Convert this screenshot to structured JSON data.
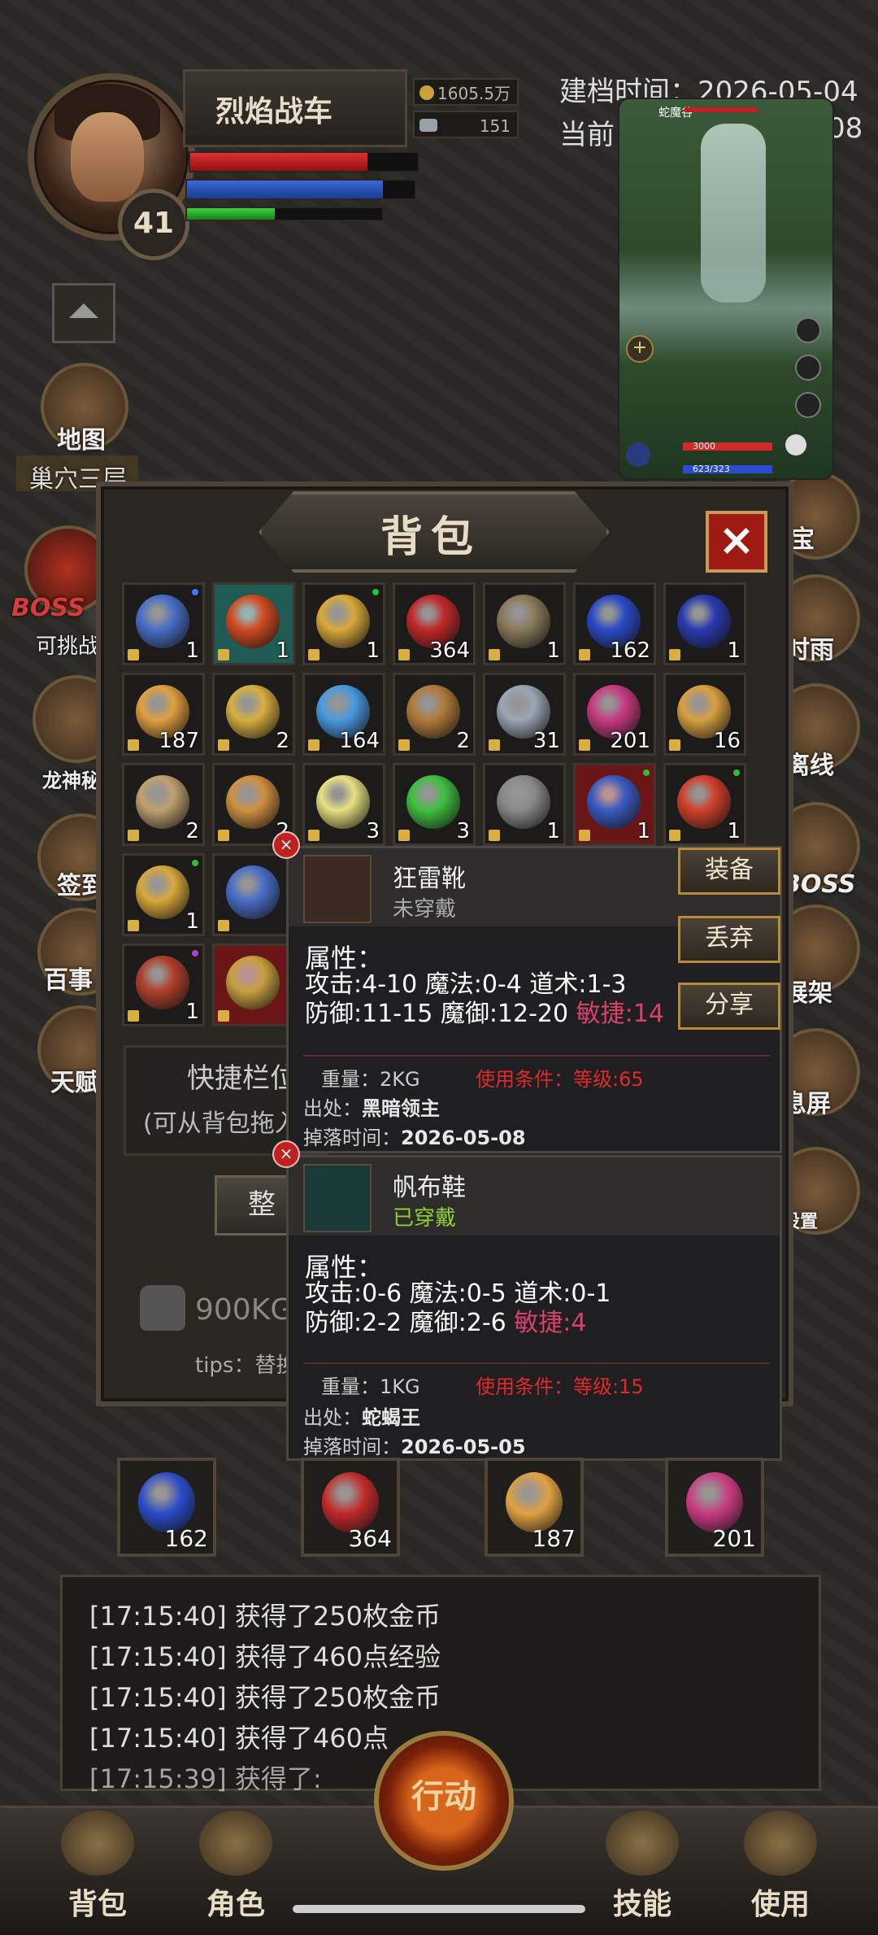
{
  "player": {
    "name": "烈焰战车",
    "level": "41",
    "gold": "1605.5万",
    "ingot": "151",
    "hp_fraction": 0.78,
    "mp_fraction": 0.86,
    "exp_fraction": 0.45
  },
  "archive": {
    "created": "建档时间：2026-05-04",
    "current_partial": "当前",
    "current_tail": "08"
  },
  "left_menu": {
    "map_label": "地图",
    "location": "巢穴三层",
    "boss_label": "BOSS",
    "challenge": "可挑战",
    "dragon": "龙神秘",
    "sign": "签到",
    "events": "百事",
    "tianshu": "天赋"
  },
  "right_menu": {
    "treasure": "宝",
    "rain": "时雨",
    "offline": "离线",
    "boss": "BOSS",
    "shelf": "展架",
    "screen": "息屏",
    "settings": "设置"
  },
  "minimap": {
    "title": "蛇魔谷",
    "hp": "3000",
    "mp": "623/323"
  },
  "bag": {
    "title": "背包",
    "close": "×",
    "quickbar_title": "快捷栏位",
    "quickbar_hint": "(可从背包拖入",
    "sort_button": "整",
    "weight": "900KG",
    "tips": "tips：替换重",
    "slots": [
      {
        "count": "1",
        "color": "#4a6ec8",
        "bg": "normal",
        "dot": "#3a7aff"
      },
      {
        "count": "1",
        "color": "#d24a20",
        "bg": "teal",
        "dot": ""
      },
      {
        "count": "1",
        "color": "#d9a83a",
        "bg": "normal",
        "dot": "#2ec02e"
      },
      {
        "count": "364",
        "color": "#c02828",
        "bg": "normal",
        "dot": ""
      },
      {
        "count": "1",
        "color": "#8a7a5a",
        "bg": "normal",
        "dot": ""
      },
      {
        "count": "162",
        "color": "#2a4ac8",
        "bg": "normal",
        "dot": ""
      },
      {
        "count": "1",
        "color": "#2a3ab0",
        "bg": "normal",
        "dot": ""
      },
      {
        "count": "187",
        "color": "#e0a040",
        "bg": "normal",
        "dot": ""
      },
      {
        "count": "2",
        "color": "#d8b040",
        "bg": "normal",
        "dot": ""
      },
      {
        "count": "164",
        "color": "#4a9ae0",
        "bg": "normal",
        "dot": ""
      },
      {
        "count": "2",
        "color": "#b07a3a",
        "bg": "normal",
        "dot": ""
      },
      {
        "count": "31",
        "color": "#9aa6b4",
        "bg": "normal",
        "dot": ""
      },
      {
        "count": "201",
        "color": "#c83a80",
        "bg": "normal",
        "dot": ""
      },
      {
        "count": "16",
        "color": "#d8a040",
        "bg": "normal",
        "dot": ""
      },
      {
        "count": "2",
        "color": "#c0a070",
        "bg": "normal",
        "dot": ""
      },
      {
        "count": "2",
        "color": "#d09040",
        "bg": "normal",
        "dot": ""
      },
      {
        "count": "3",
        "color": "#e8e080",
        "bg": "normal",
        "dot": ""
      },
      {
        "count": "3",
        "color": "#40c040",
        "bg": "normal",
        "dot": ""
      },
      {
        "count": "1",
        "color": "#8a8a8a",
        "bg": "normal",
        "dot": ""
      },
      {
        "count": "1",
        "color": "#3a5ac0",
        "bg": "red",
        "dot": "#2ec02e"
      },
      {
        "count": "1",
        "color": "#d0402a",
        "bg": "normal",
        "dot": "#2ec02e"
      },
      {
        "count": "1",
        "color": "#d9a83a",
        "bg": "normal",
        "dot": "#2ec02e"
      },
      {
        "count": "",
        "color": "#4a6ec8",
        "bg": "normal",
        "dot": ""
      },
      {
        "count": "",
        "color": "",
        "bg": "normal",
        "dot": ""
      },
      {
        "count": "",
        "color": "",
        "bg": "normal",
        "dot": ""
      },
      {
        "count": "",
        "color": "",
        "bg": "normal",
        "dot": ""
      },
      {
        "count": "",
        "color": "",
        "bg": "normal",
        "dot": ""
      },
      {
        "count": "",
        "color": "",
        "bg": "normal",
        "dot": ""
      },
      {
        "count": "1",
        "color": "#b0402a",
        "bg": "normal",
        "dot": "#b040d0"
      },
      {
        "count": "",
        "color": "#c8a040",
        "bg": "red",
        "dot": ""
      },
      {
        "count": "",
        "color": "",
        "bg": "normal",
        "dot": ""
      },
      {
        "count": "",
        "color": "",
        "bg": "normal",
        "dot": ""
      },
      {
        "count": "",
        "color": "",
        "bg": "normal",
        "dot": ""
      },
      {
        "count": "",
        "color": "",
        "bg": "normal",
        "dot": ""
      },
      {
        "count": "",
        "color": "",
        "bg": "normal",
        "dot": ""
      }
    ]
  },
  "tooltip_new": {
    "name": "狂雷靴",
    "status": "未穿戴",
    "attr_header": "属性：",
    "line1": "攻击:4-10  魔法:0-4  道术:1-3",
    "line2a": "防御:11-15  魔御:12-20 ",
    "line2b": "敏捷:14",
    "weight": "重量：2KG",
    "requirement": "使用条件：等级:65",
    "source_label": "出处：",
    "source": "黑暗领主",
    "drop_label": "掉落时间：",
    "drop_time": "2026-05-08",
    "close": "×"
  },
  "tooltip_worn": {
    "name": "帆布鞋",
    "status": "已穿戴",
    "attr_header": "属性：",
    "line1": "攻击:0-6  魔法:0-5  道术:0-1",
    "line2a": "防御:2-2  魔御:2-6 ",
    "line2b": "敏捷:4",
    "weight": "重量：1KG",
    "requirement": "使用条件：等级:15",
    "source_label": "出处：",
    "source": "蛇蝎王",
    "drop_label": "掉落时间：",
    "drop_time": "2026-05-05",
    "close": "×"
  },
  "actions": {
    "equip": "装备",
    "discard": "丢弃",
    "share": "分享"
  },
  "quickbar": [
    {
      "count": "162",
      "color": "#2a4ac8"
    },
    {
      "count": "364",
      "color": "#c02828"
    },
    {
      "count": "187",
      "color": "#e0a040"
    },
    {
      "count": "201",
      "color": "#c83a80"
    }
  ],
  "log": [
    "[17:15:40] 获得了250枚金币",
    "[17:15:40] 获得了460点经验",
    "[17:15:40] 获得了250枚金币",
    "[17:15:40] 获得了460点",
    "[17:15:39] 获得了:"
  ],
  "nav": {
    "bag": "背包",
    "role": "角色",
    "action": "行动",
    "skill": "技能",
    "use": "使用"
  }
}
